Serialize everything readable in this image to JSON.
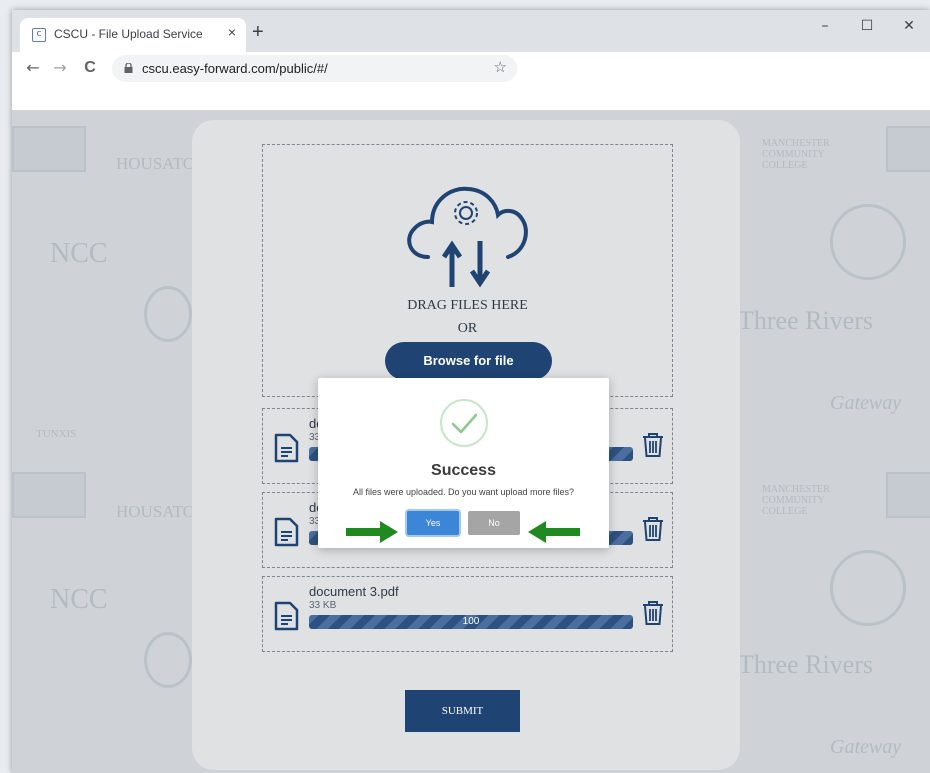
{
  "browser": {
    "tab_title": "CSCU - File Upload Service",
    "tab_close": "×",
    "new_tab": "+",
    "minimize": "–",
    "maximize": "☐",
    "close": "✕",
    "back": "←",
    "forward": "→",
    "reload": "C",
    "url": "cscu.easy-forward.com/public/#/",
    "bookmark": "☆"
  },
  "upload": {
    "drag_text": "DRAG FILES HERE",
    "or_text": "OR",
    "browse_label": "Browse for file",
    "submit_label": "SUBMIT"
  },
  "files": [
    {
      "name": "document 1.pdf",
      "size": "33 KB",
      "progress": 100
    },
    {
      "name": "document 2.pdf",
      "size": "33 KB",
      "progress": 100
    },
    {
      "name": "document 3.pdf",
      "size": "33 KB",
      "progress": 100
    }
  ],
  "files_visible_names": [
    "doc",
    "doc",
    "document 3.pdf"
  ],
  "files_visible_sizes": [
    "33 K",
    "33 K",
    "33 KB"
  ],
  "dialog": {
    "title": "Success",
    "message": "All files were uploaded. Do you want upload more files?",
    "yes_label": "Yes",
    "no_label": "No"
  },
  "background_logos": [
    "NCC",
    "Three Rivers",
    "Gateway",
    "MANCHESTER COMMUNITY COLLEGE",
    "HOUSATONIC",
    "TUNXIS"
  ],
  "colors": {
    "primary": "#1f4473",
    "accent_green": "#1f8a1f",
    "yes_blue": "#3b86d6",
    "no_gray": "#a5a5a5",
    "success_check": "#8cc98c"
  }
}
